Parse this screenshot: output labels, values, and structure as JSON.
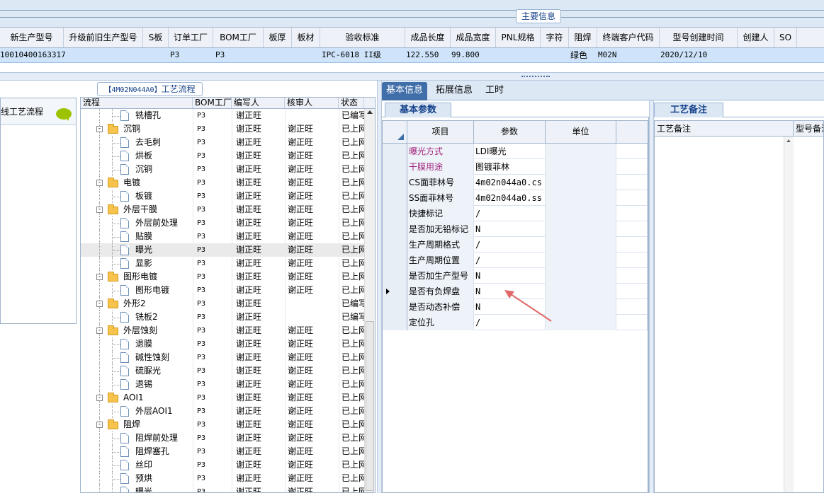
{
  "top": {
    "main_info_tab": "主要信息",
    "columns": [
      "新生产型号",
      "升级前旧生产型号",
      "S板",
      "订单工厂",
      "BOM工厂",
      "板厚",
      "板材",
      "验收标准",
      "成品长度",
      "成品宽度",
      "PNL规格",
      "字符",
      "阻焊",
      "终端客户代码",
      "型号创建时间",
      "创建人",
      "SO"
    ],
    "row": {
      "new_model": "10010400163317",
      "order_factory": "P3",
      "bom_factory": "P3",
      "standard": "IPC-6018 II级",
      "length": "122.550",
      "width": "99.800",
      "solder_mask": "绿色",
      "customer_code": "M02N",
      "created": "2020/12/10"
    }
  },
  "left": {
    "process_tab_code": "【4M02N044A0】",
    "process_tab_label": "工艺流程",
    "offline_title": "线工艺流程",
    "tree_columns": [
      "流程",
      "BOM工厂",
      "编写人",
      "核审人",
      "状态"
    ],
    "rows": [
      {
        "name": "铣槽孔",
        "level": 1,
        "bom": "P3",
        "writer": "谢正旺",
        "reviewer": "",
        "status": "已编写"
      },
      {
        "name": "沉铜",
        "level": 0,
        "bom": "P3",
        "writer": "谢正旺",
        "reviewer": "谢正旺",
        "status": "已上网"
      },
      {
        "name": "去毛刺",
        "level": 1,
        "bom": "P3",
        "writer": "谢正旺",
        "reviewer": "谢正旺",
        "status": "已上网"
      },
      {
        "name": "烘板",
        "level": 1,
        "bom": "P3",
        "writer": "谢正旺",
        "reviewer": "谢正旺",
        "status": "已上网"
      },
      {
        "name": "沉铜",
        "level": 1,
        "bom": "P3",
        "writer": "谢正旺",
        "reviewer": "谢正旺",
        "status": "已上网"
      },
      {
        "name": "电镀",
        "level": 0,
        "bom": "P3",
        "writer": "谢正旺",
        "reviewer": "谢正旺",
        "status": "已上网"
      },
      {
        "name": "板镀",
        "level": 1,
        "bom": "P3",
        "writer": "谢正旺",
        "reviewer": "谢正旺",
        "status": "已上网"
      },
      {
        "name": "外层干膜",
        "level": 0,
        "bom": "P3",
        "writer": "谢正旺",
        "reviewer": "谢正旺",
        "status": "已上网"
      },
      {
        "name": "外层前处理",
        "level": 1,
        "bom": "P3",
        "writer": "谢正旺",
        "reviewer": "谢正旺",
        "status": "已上网"
      },
      {
        "name": "贴膜",
        "level": 1,
        "bom": "P3",
        "writer": "谢正旺",
        "reviewer": "谢正旺",
        "status": "已上网"
      },
      {
        "name": "曝光",
        "level": 1,
        "bom": "P3",
        "writer": "谢正旺",
        "reviewer": "谢正旺",
        "status": "已上网",
        "selected": true
      },
      {
        "name": "显影",
        "level": 1,
        "bom": "P3",
        "writer": "谢正旺",
        "reviewer": "谢正旺",
        "status": "已上网"
      },
      {
        "name": "图形电镀",
        "level": 0,
        "bom": "P3",
        "writer": "谢正旺",
        "reviewer": "谢正旺",
        "status": "已上网"
      },
      {
        "name": "图形电镀",
        "level": 1,
        "bom": "P3",
        "writer": "谢正旺",
        "reviewer": "谢正旺",
        "status": "已上网"
      },
      {
        "name": "外形2",
        "level": 0,
        "bom": "P3",
        "writer": "谢正旺",
        "reviewer": "",
        "status": "已编写"
      },
      {
        "name": "铣板2",
        "level": 1,
        "bom": "P3",
        "writer": "谢正旺",
        "reviewer": "",
        "status": "已编写"
      },
      {
        "name": "外层蚀刻",
        "level": 0,
        "bom": "P3",
        "writer": "谢正旺",
        "reviewer": "谢正旺",
        "status": "已上网"
      },
      {
        "name": "退膜",
        "level": 1,
        "bom": "P3",
        "writer": "谢正旺",
        "reviewer": "谢正旺",
        "status": "已上网"
      },
      {
        "name": "碱性蚀刻",
        "level": 1,
        "bom": "P3",
        "writer": "谢正旺",
        "reviewer": "谢正旺",
        "status": "已上网"
      },
      {
        "name": "硫脲光",
        "level": 1,
        "bom": "P3",
        "writer": "谢正旺",
        "reviewer": "谢正旺",
        "status": "已上网"
      },
      {
        "name": "退锡",
        "level": 1,
        "bom": "P3",
        "writer": "谢正旺",
        "reviewer": "谢正旺",
        "status": "已上网"
      },
      {
        "name": "AOI1",
        "level": 0,
        "bom": "P3",
        "writer": "谢正旺",
        "reviewer": "谢正旺",
        "status": "已上网"
      },
      {
        "name": "外层AOI1",
        "level": 1,
        "bom": "P3",
        "writer": "谢正旺",
        "reviewer": "谢正旺",
        "status": "已上网"
      },
      {
        "name": "阻焊",
        "level": 0,
        "bom": "P3",
        "writer": "谢正旺",
        "reviewer": "谢正旺",
        "status": "已上网"
      },
      {
        "name": "阻焊前处理",
        "level": 1,
        "bom": "P3",
        "writer": "谢正旺",
        "reviewer": "谢正旺",
        "status": "已上网"
      },
      {
        "name": "阻焊塞孔",
        "level": 1,
        "bom": "P3",
        "writer": "谢正旺",
        "reviewer": "谢正旺",
        "status": "已上网"
      },
      {
        "name": "丝印",
        "level": 1,
        "bom": "P3",
        "writer": "谢正旺",
        "reviewer": "谢正旺",
        "status": "已上网"
      },
      {
        "name": "预烘",
        "level": 1,
        "bom": "P3",
        "writer": "谢正旺",
        "reviewer": "谢正旺",
        "status": "已上网"
      },
      {
        "name": "曝光",
        "level": 1,
        "bom": "P3",
        "writer": "谢正旺",
        "reviewer": "谢正旺",
        "status": "已上网"
      }
    ]
  },
  "right": {
    "tabs": [
      "基本信息",
      "拓展信息",
      "工时"
    ],
    "params_tab": "基本参数",
    "param_columns": [
      "项目",
      "参数",
      "单位"
    ],
    "params": [
      {
        "item": "曝光方式",
        "value": "LDI曝光",
        "highlight": true
      },
      {
        "item": "干膜用途",
        "value": "图镀菲林",
        "highlight": true
      },
      {
        "item": "CS面菲林号",
        "value": "4m02n044a0.cs"
      },
      {
        "item": "SS面菲林号",
        "value": "4m02n044a0.ss"
      },
      {
        "item": "快捷标记",
        "value": "/"
      },
      {
        "item": "是否加无铅标记",
        "value": "N"
      },
      {
        "item": "生产周期格式",
        "value": "/"
      },
      {
        "item": "生产周期位置",
        "value": "/"
      },
      {
        "item": "是否加生产型号",
        "value": "N"
      },
      {
        "item": "是否有负焊盘",
        "value": "N",
        "current": true
      },
      {
        "item": "是否动态补偿",
        "value": "N"
      },
      {
        "item": "定位孔",
        "value": "/"
      }
    ],
    "notes_tab": "工艺备注",
    "notes_col": "工艺备注",
    "notes_col2": "型号备注"
  },
  "colors": {
    "accent": "#3f6ea8",
    "highlight_text": "#a0237a",
    "annotation": "#e06a6a"
  }
}
